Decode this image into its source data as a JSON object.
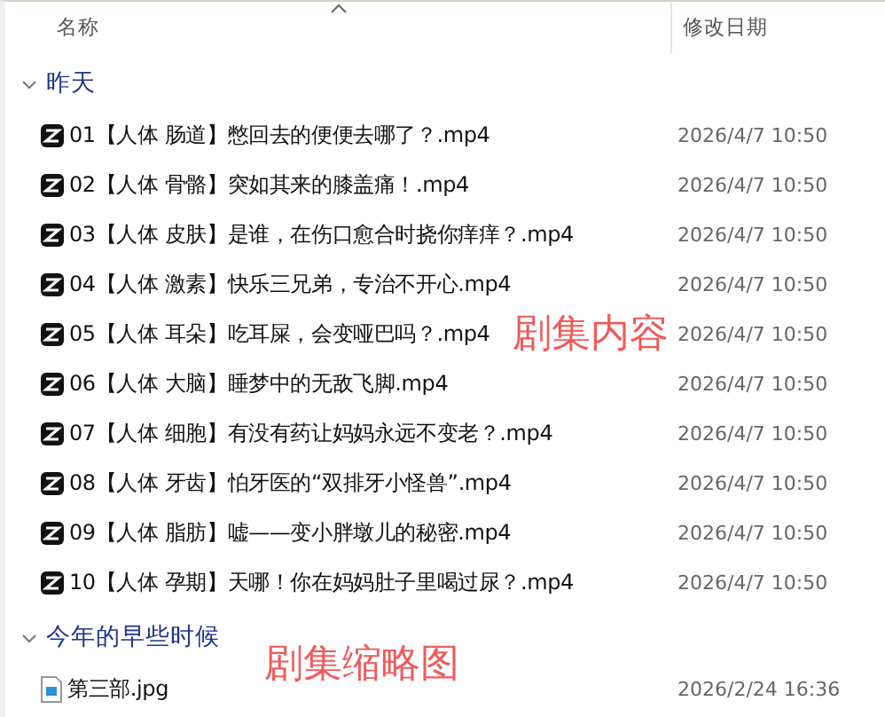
{
  "columns": [
    {
      "label": "名称",
      "sorted": true
    },
    {
      "label": "修改日期",
      "sorted": false
    }
  ],
  "groups": [
    {
      "label": "昨天",
      "expanded": true,
      "files": [
        {
          "kind": "video",
          "name": "01【人体 肠道】憋回去的便便去哪了？.mp4",
          "date": "2026/4/7 10:50"
        },
        {
          "kind": "video",
          "name": "02【人体 骨骼】突如其来的膝盖痛！.mp4",
          "date": "2026/4/7 10:50"
        },
        {
          "kind": "video",
          "name": "03【人体 皮肤】是谁，在伤口愈合时挠你痒痒？.mp4",
          "date": "2026/4/7 10:50"
        },
        {
          "kind": "video",
          "name": "04【人体 激素】快乐三兄弟，专治不开心.mp4",
          "date": "2026/4/7 10:50"
        },
        {
          "kind": "video",
          "name": "05【人体 耳朵】吃耳屎，会变哑巴吗？.mp4",
          "date": "2026/4/7 10:50"
        },
        {
          "kind": "video",
          "name": "06【人体 大脑】睡梦中的无敌飞脚.mp4",
          "date": "2026/4/7 10:50"
        },
        {
          "kind": "video",
          "name": "07【人体 细胞】有没有药让妈妈永远不变老？.mp4",
          "date": "2026/4/7 10:50"
        },
        {
          "kind": "video",
          "name": "08【人体 牙齿】怕牙医的“双排牙小怪兽”.mp4",
          "date": "2026/4/7 10:50"
        },
        {
          "kind": "video",
          "name": "09【人体 脂肪】嘘——变小胖墩儿的秘密.mp4",
          "date": "2026/4/7 10:50"
        },
        {
          "kind": "video",
          "name": "10【人体 孕期】天哪！你在妈妈肚子里喝过尿？.mp4",
          "date": "2026/4/7 10:50"
        }
      ]
    },
    {
      "label": "今年的早些时候",
      "expanded": true,
      "files": [
        {
          "kind": "image",
          "name": "第三部.jpg",
          "date": "2026/2/24 16:36"
        }
      ]
    }
  ],
  "annotations": [
    "剧集内容",
    "剧集缩略图"
  ]
}
